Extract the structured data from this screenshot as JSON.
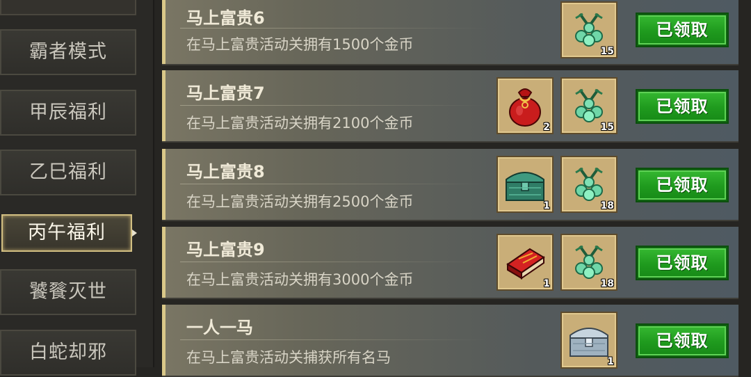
{
  "sidebar": {
    "items": [
      {
        "label": "霸者模式"
      },
      {
        "label": "甲辰福利"
      },
      {
        "label": "乙巳福利"
      },
      {
        "label": "丙午福利",
        "active": true
      },
      {
        "label": "饕餮灭世"
      },
      {
        "label": "白蛇却邪"
      }
    ]
  },
  "tasks": [
    {
      "title": "马上富贵6",
      "desc": "在马上富贵活动关拥有1500个金币",
      "rewards": [
        {
          "icon": "jade-beads-icon",
          "qty": "15"
        }
      ],
      "button": "已领取"
    },
    {
      "title": "马上富贵7",
      "desc": "在马上富贵活动关拥有2100个金币",
      "rewards": [
        {
          "icon": "red-money-bag-icon",
          "qty": "2"
        },
        {
          "icon": "jade-beads-icon",
          "qty": "15"
        }
      ],
      "button": "已领取"
    },
    {
      "title": "马上富贵8",
      "desc": "在马上富贵活动关拥有2500个金币",
      "rewards": [
        {
          "icon": "jade-chest-icon",
          "qty": "1"
        },
        {
          "icon": "jade-beads-icon",
          "qty": "18"
        }
      ],
      "button": "已领取"
    },
    {
      "title": "马上富贵9",
      "desc": "在马上富贵活动关拥有3000个金币",
      "rewards": [
        {
          "icon": "red-book-icon",
          "qty": "1"
        },
        {
          "icon": "jade-beads-icon",
          "qty": "18"
        }
      ],
      "button": "已领取"
    },
    {
      "title": "一人一马",
      "desc": "在马上富贵活动关捕获所有名马",
      "rewards": [
        {
          "icon": "silver-chest-icon",
          "qty": "1"
        }
      ],
      "button": "已领取"
    }
  ],
  "colors": {
    "accent": "#d9c889",
    "claim_green": "#1f9a1e",
    "slot_gold": "#c9ae78"
  }
}
